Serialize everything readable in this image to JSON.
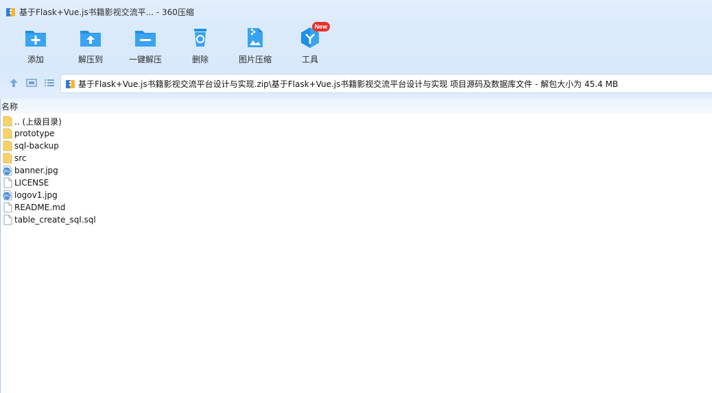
{
  "window": {
    "title": "基于Flask+Vue.js书籍影视交流平... - 360压缩"
  },
  "toolbar": {
    "items": [
      {
        "label": "添加",
        "icon": "add-folder-icon"
      },
      {
        "label": "解压到",
        "icon": "extract-to-icon"
      },
      {
        "label": "一键解压",
        "icon": "one-click-extract-icon"
      },
      {
        "label": "删除",
        "icon": "delete-bin-icon"
      },
      {
        "label": "图片压缩",
        "icon": "image-compress-icon"
      },
      {
        "label": "工具",
        "icon": "tools-icon"
      }
    ],
    "badge": "New"
  },
  "address": {
    "path": "基于Flask+Vue.js书籍影视交流平台设计与实现.zip\\基于Flask+Vue.js书籍影视交流平台设计与实现 项目源码及数据库文件 - 解包大小为 45.4 MB"
  },
  "list": {
    "column_name": "名称",
    "files": [
      {
        "name": ".. (上级目录)",
        "type": "folder"
      },
      {
        "name": "prototype",
        "type": "folder"
      },
      {
        "name": "sql-backup",
        "type": "folder"
      },
      {
        "name": "src",
        "type": "folder"
      },
      {
        "name": "banner.jpg",
        "type": "jpg"
      },
      {
        "name": "LICENSE",
        "type": "file"
      },
      {
        "name": "logov1.jpg",
        "type": "jpg"
      },
      {
        "name": "README.md",
        "type": "file"
      },
      {
        "name": "table_create_sql.sql",
        "type": "file"
      }
    ]
  },
  "colors": {
    "accent": "#1e8fe8",
    "toolbar_bg": "#dcebfb",
    "folder": "#f7d36b",
    "badge": "#e8312a"
  }
}
